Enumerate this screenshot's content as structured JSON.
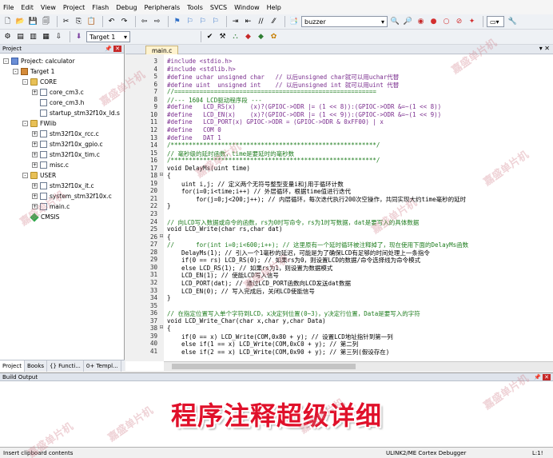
{
  "menu": [
    "File",
    "Edit",
    "View",
    "Project",
    "Flash",
    "Debug",
    "Peripherals",
    "Tools",
    "SVCS",
    "Window",
    "Help"
  ],
  "toolbar": {
    "find_value": "buzzer",
    "target_value": "Target 1"
  },
  "project_panel": {
    "title": "Project",
    "tree": [
      {
        "label": "Project: calculator",
        "level": 0,
        "type": "proj",
        "expander": "-"
      },
      {
        "label": "Target 1",
        "level": 1,
        "type": "target",
        "expander": "-"
      },
      {
        "label": "CORE",
        "level": 2,
        "type": "folder",
        "expander": "-"
      },
      {
        "label": "core_cm3.c",
        "level": 3,
        "type": "file",
        "expander": "+"
      },
      {
        "label": "core_cm3.h",
        "level": 3,
        "type": "file",
        "expander": ""
      },
      {
        "label": "startup_stm32f10x_ld.s",
        "level": 3,
        "type": "file",
        "expander": ""
      },
      {
        "label": "FWlib",
        "level": 2,
        "type": "folder",
        "expander": "-"
      },
      {
        "label": "stm32f10x_rcc.c",
        "level": 3,
        "type": "file",
        "expander": "+"
      },
      {
        "label": "stm32f10x_gpio.c",
        "level": 3,
        "type": "file",
        "expander": "+"
      },
      {
        "label": "stm32f10x_tim.c",
        "level": 3,
        "type": "file",
        "expander": "+"
      },
      {
        "label": "misc.c",
        "level": 3,
        "type": "file",
        "expander": "+"
      },
      {
        "label": "USER",
        "level": 2,
        "type": "folder",
        "expander": "-"
      },
      {
        "label": "stm32f10x_it.c",
        "level": 3,
        "type": "file",
        "expander": "+"
      },
      {
        "label": "system_stm32f10x.c",
        "level": 3,
        "type": "file",
        "expander": "+"
      },
      {
        "label": "main.c",
        "level": 3,
        "type": "file",
        "expander": "+"
      },
      {
        "label": "CMSIS",
        "level": 2,
        "type": "gem",
        "expander": ""
      }
    ],
    "tabs": [
      "Project",
      "Books",
      "{} Functi...",
      "0+ Templ..."
    ]
  },
  "editor": {
    "tab_label": "main.c",
    "lines": [
      {
        "n": "3",
        "fold": "",
        "kind": "pre",
        "text": "#include <stdio.h>"
      },
      {
        "n": "4",
        "fold": "",
        "kind": "pre",
        "text": "#include <stdlib.h>"
      },
      {
        "n": "5",
        "fold": "",
        "kind": "pre",
        "text": "#define uchar unsigned char   // 以后unsigned char就可以用uchar代替"
      },
      {
        "n": "6",
        "fold": "",
        "kind": "pre",
        "text": "#define uint  unsigned int    // 以后unsigned int 就可以用uint 代替"
      },
      {
        "n": "7",
        "fold": "",
        "kind": "cm",
        "text": "//========================================================"
      },
      {
        "n": "8",
        "fold": "",
        "kind": "cm",
        "text": "//--- 1604 LCD驱动程序段 ---"
      },
      {
        "n": "9",
        "fold": "",
        "kind": "pre",
        "text": "#define   LCD_RS(x)    (x)?(GPIOC->ODR |= (1 << 8)):(GPIOC->ODR &=~(1 << 8))"
      },
      {
        "n": "10",
        "fold": "",
        "kind": "pre",
        "text": "#define   LCD_EN(x)    (x)?(GPIOC->ODR |= (1 << 9)):(GPIOC->ODR &=~(1 << 9))"
      },
      {
        "n": "11",
        "fold": "",
        "kind": "pre",
        "text": "#define   LCD_PORT(x) GPIOC->ODR = (GPIOC->ODR & 0xFF00) | x"
      },
      {
        "n": "12",
        "fold": "",
        "kind": "pre",
        "text": "#define   COM 0"
      },
      {
        "n": "13",
        "fold": "",
        "kind": "pre",
        "text": "#define   DAT 1"
      },
      {
        "n": "14",
        "fold": "",
        "kind": "cm",
        "text": "/*********************************************************/"
      },
      {
        "n": "15",
        "fold": "",
        "kind": "cm",
        "text": "// 毫秒级的延时函数，time是要延时的毫秒数"
      },
      {
        "n": "16",
        "fold": "",
        "kind": "cm",
        "text": "/*********************************************************/"
      },
      {
        "n": "17",
        "fold": "",
        "kind": "code",
        "text": "void DelayMs(uint time)"
      },
      {
        "n": "18",
        "fold": "-",
        "kind": "code",
        "text": "{"
      },
      {
        "n": "19",
        "fold": "",
        "kind": "code",
        "text": "    uint i,j; // 定义两个无符号整型变量i和j用于循环计数"
      },
      {
        "n": "20",
        "fold": "",
        "kind": "code",
        "text": "    for(i=0;i<time;i++) // 外层循环，根据time值进行迭代"
      },
      {
        "n": "21",
        "fold": "",
        "kind": "code",
        "text": "        for(j=0;j<200;j++); // 内层循环，每次迭代执行200次空操作，共同实现大约time毫秒的延时"
      },
      {
        "n": "22",
        "fold": "",
        "kind": "code",
        "text": "}"
      },
      {
        "n": "23",
        "fold": "",
        "kind": "code",
        "text": ""
      },
      {
        "n": "24",
        "fold": "",
        "kind": "cm",
        "text": "// 向LCD写入数据或命令的函数，rs为0时写命令，rs为1时写数据，dat是要写入的具体数据"
      },
      {
        "n": "25",
        "fold": "",
        "kind": "code",
        "text": "void LCD_Write(char rs,char dat)"
      },
      {
        "n": "26",
        "fold": "-",
        "kind": "code",
        "text": "{"
      },
      {
        "n": "27",
        "fold": "",
        "kind": "cm",
        "text": "//      for(int i=0;i<600;i++); // 这里原有一个延时循环被注释掉了，现在使用下面的DelayMs函数"
      },
      {
        "n": "28",
        "fold": "",
        "kind": "code",
        "text": "    DelayMs(1); // 引入一个1毫秒的延迟，可能是为了确保LCD有足够的时间处理上一条指令"
      },
      {
        "n": "29",
        "fold": "",
        "kind": "code",
        "text": "    if(0 == rs) LCD_RS(0); // 如果rs为0，则设置LCD的数据/命令选择线为命令模式"
      },
      {
        "n": "30",
        "fold": "",
        "kind": "code",
        "text": "    else LCD_RS(1); // 如果rs为1，则设置为数据模式"
      },
      {
        "n": "31",
        "fold": "",
        "kind": "code",
        "text": "    LCD_EN(1); // 使能LCD写入信号"
      },
      {
        "n": "32",
        "fold": "",
        "kind": "code",
        "text": "    LCD_PORT(dat); // 通过LCD_PORT函数向LCD发送dat数据"
      },
      {
        "n": "33",
        "fold": "",
        "kind": "code",
        "text": "    LCD_EN(0); // 写入完成后，关闭LCD使能信号"
      },
      {
        "n": "34",
        "fold": "",
        "kind": "code",
        "text": "}"
      },
      {
        "n": "35",
        "fold": "",
        "kind": "code",
        "text": ""
      },
      {
        "n": "36",
        "fold": "",
        "kind": "cm",
        "text": "// 在指定位置写入单个字符到LCD，x决定列位置(0~3)，y决定行位置，Data是要写入的字符"
      },
      {
        "n": "37",
        "fold": "",
        "kind": "code",
        "text": "void LCD_Write_Char(char x,char y,char Data)"
      },
      {
        "n": "38",
        "fold": "-",
        "kind": "code",
        "text": "{"
      },
      {
        "n": "39",
        "fold": "",
        "kind": "code",
        "text": "    if(0 == x) LCD_Write(COM,0x80 + y); // 设置LCD地址指针到第一列"
      },
      {
        "n": "40",
        "fold": "",
        "kind": "code",
        "text": "    else if(1 == x) LCD_Write(COM,0xC0 + y); // 第二列"
      },
      {
        "n": "41",
        "fold": "",
        "kind": "code",
        "text": "    else if(2 == x) LCD_Write(COM,0x90 + y); // 第三列(假设存在)"
      }
    ]
  },
  "build_output": {
    "title": "Build Output",
    "banner": "程序注释超级详细"
  },
  "status": {
    "left": "Insert clipboard contents",
    "debugger": "ULINK2/ME Cortex Debugger",
    "position": "L:1!"
  },
  "watermark": "嘉盛单片机",
  "colors": {
    "banner": "#e0102a",
    "preprocessor": "#7a2d8e",
    "comment": "#1f7d1f"
  }
}
